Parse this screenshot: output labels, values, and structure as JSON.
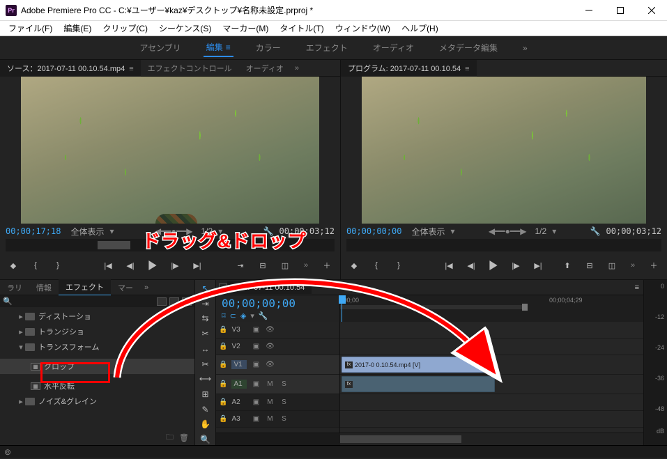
{
  "window": {
    "app_short": "Pr",
    "title": "Adobe Premiere Pro CC - C:¥ユーザー¥kaz¥デスクトップ¥名称未設定.prproj *"
  },
  "menu": {
    "file": "ファイル(F)",
    "edit": "編集(E)",
    "clip": "クリップ(C)",
    "sequence": "シーケンス(S)",
    "marker": "マーカー(M)",
    "title": "タイトル(T)",
    "window": "ウィンドウ(W)",
    "help": "ヘルプ(H)"
  },
  "workspaces": {
    "assembly": "アセンブリ",
    "editing": "編集",
    "color": "カラー",
    "effects": "エフェクト",
    "audio": "オーディオ",
    "metadata": "メタデータ編集"
  },
  "source": {
    "tab_label": "ソース：2017-07-11 00.10.54.mp4",
    "tab_effect_controls": "エフェクトコントロール",
    "tab_audio": "オーディオ",
    "tc_current": "00;00;17;18",
    "fit_label": "全体表示",
    "scale_label": "1/2",
    "tc_duration": "00;00;03;12"
  },
  "program": {
    "tab_label": "プログラム: 2017-07-11 00.10.54",
    "tc_current": "00;00;00;00",
    "fit_label": "全体表示",
    "scale_label": "1/2",
    "tc_duration": "00;00;03;12"
  },
  "effects_panel": {
    "tab_library": "ラリ",
    "tab_info": "情報",
    "tab_effects": "エフェクト",
    "tab_markers": "マー",
    "tree": {
      "distortion": "ディストーショ",
      "transition": "トランジショ",
      "transform": "トランスフォーム",
      "crop": "クロップ",
      "hflip": "水平反転",
      "noise": "ノイズ&グレイン"
    }
  },
  "timeline": {
    "tab": "2017-07-11 00.10.54",
    "tc": "00;00;00;00",
    "ruler_start": ";00;00",
    "ruler_mid": "00;00;04;29",
    "tracks": {
      "v3": "V3",
      "v2": "V2",
      "v1": "V1",
      "a1": "A1",
      "a2": "A2",
      "a3": "A3"
    },
    "toggles": {
      "m": "M",
      "s": "S"
    },
    "clip_v1": "2017-0           0.10.54.mp4 [V]"
  },
  "meters": {
    "m0": "0",
    "m12": "-12",
    "m24": "-24",
    "m36": "-36",
    "m48": "-48",
    "mdb": "dB"
  },
  "annotation": {
    "text": "ドラッグ&ドロップ"
  }
}
